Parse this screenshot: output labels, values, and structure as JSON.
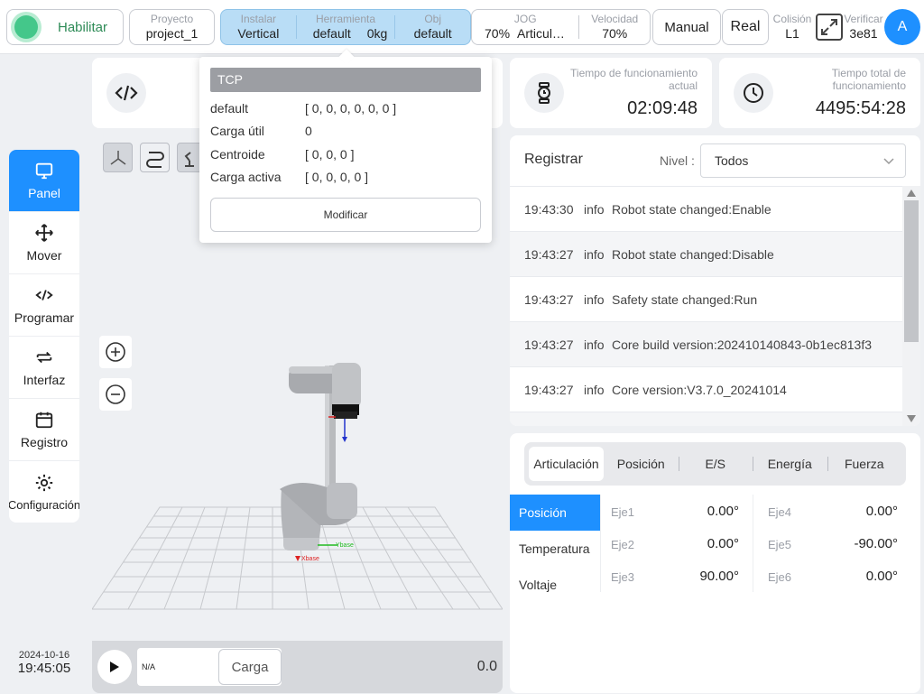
{
  "topbar": {
    "enable_label": "Habilitar",
    "project": {
      "key": "Proyecto",
      "value": "project_1"
    },
    "install": {
      "key": "Instalar",
      "value": "Vertical"
    },
    "tool": {
      "key": "Herramienta",
      "value": "default",
      "load": "0kg"
    },
    "obj": {
      "key": "Obj",
      "value": "default"
    },
    "jog": {
      "key": "JOG",
      "value": "70%",
      "mode": "Articul…"
    },
    "speed": {
      "key": "Velocidad",
      "value": "70%"
    },
    "manual_label": "Manual",
    "real_label": "Real",
    "collision": {
      "key": "Colisión",
      "value": "L1"
    },
    "verify": {
      "key": "Verificar",
      "value": "3e81"
    },
    "avatar_letter": "A"
  },
  "sidebar": {
    "items": [
      {
        "label": "Panel",
        "icon": "monitor-icon"
      },
      {
        "label": "Mover",
        "icon": "move-arrows-icon"
      },
      {
        "label": "Programar",
        "icon": "code-icon"
      },
      {
        "label": "Interfaz",
        "icon": "exchange-icon"
      },
      {
        "label": "Registro",
        "icon": "calendar-icon"
      },
      {
        "label": "Configuración",
        "icon": "gear-icon"
      }
    ],
    "date": "2024-10-16",
    "time": "19:45:05"
  },
  "tcp_popup": {
    "header": "TCP",
    "rows": [
      {
        "key": "default",
        "value": "[ 0, 0, 0, 0, 0, 0 ]"
      },
      {
        "key": "Carga útil",
        "value": "0"
      },
      {
        "key": "Centroide",
        "value": "[ 0, 0, 0 ]"
      },
      {
        "key": "Carga activa",
        "value": "[ 0, 0, 0, 0 ]"
      }
    ],
    "modify_label": "Modificar"
  },
  "uptime": {
    "label": "Tiempo de funcionamiento actual",
    "value": "02:09:48"
  },
  "total_uptime": {
    "label": "Tiempo total de funcionamiento",
    "value": "4495:54:28"
  },
  "viewport": {
    "axis_labels": {
      "x": "Xbase",
      "y": "Ybase"
    },
    "playbar": {
      "program_value": "N/A",
      "load_label": "Carga",
      "speed_value": "0.0"
    }
  },
  "log": {
    "title": "Registrar",
    "level_label": "Nivel :",
    "level_value": "Todos",
    "rows": [
      {
        "time": "19:43:30",
        "level": "info",
        "message": "Robot state changed:Enable"
      },
      {
        "time": "19:43:27",
        "level": "info",
        "message": "Robot state changed:Disable"
      },
      {
        "time": "19:43:27",
        "level": "info",
        "message": "Safety state changed:Run"
      },
      {
        "time": "19:43:27",
        "level": "info",
        "message": "Core build version:202410140843-0b1ec813f3"
      },
      {
        "time": "19:43:27",
        "level": "info",
        "message": "Core version:V3.7.0_20241014"
      }
    ]
  },
  "joints": {
    "tabs": [
      "Articulación",
      "Posición",
      "E/S",
      "Energía",
      "Fuerza"
    ],
    "subtabs": [
      "Posición",
      "Temperatura",
      "Voltaje"
    ],
    "values": [
      {
        "name": "Eje1",
        "value": "0.00°"
      },
      {
        "name": "Eje2",
        "value": "0.00°"
      },
      {
        "name": "Eje3",
        "value": "90.00°"
      },
      {
        "name": "Eje4",
        "value": "0.00°"
      },
      {
        "name": "Eje5",
        "value": "-90.00°"
      },
      {
        "name": "Eje6",
        "value": "0.00°"
      }
    ]
  }
}
